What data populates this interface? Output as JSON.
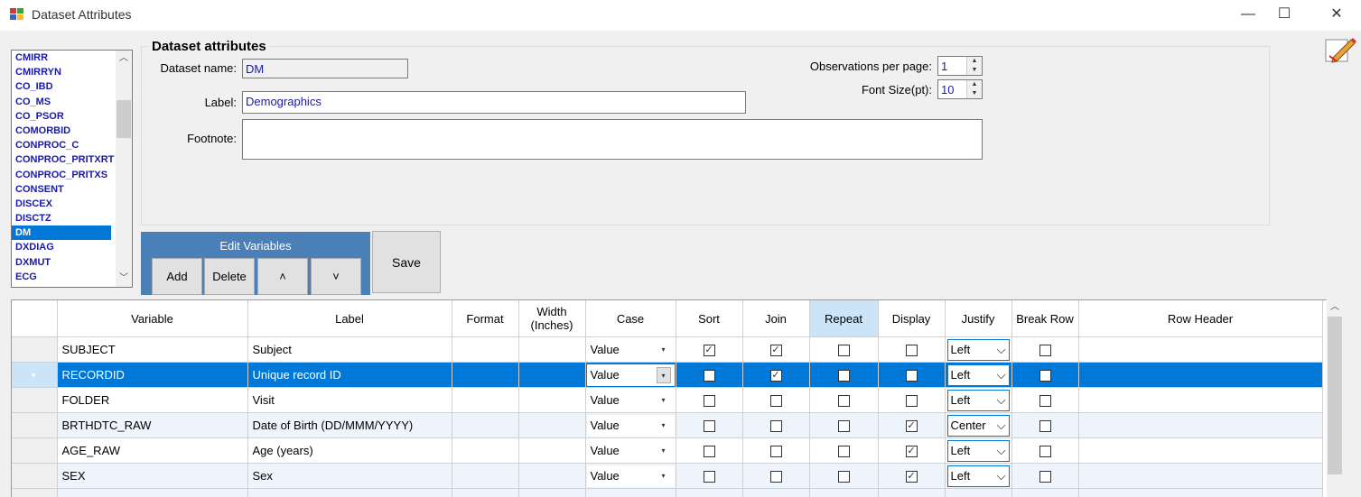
{
  "window": {
    "title": "Dataset Attributes",
    "minimize": "—",
    "maximize": "☐",
    "close": "✕"
  },
  "datasets": {
    "items": [
      "CMIRR",
      "CMIRRYN",
      "CO_IBD",
      "CO_MS",
      "CO_PSOR",
      "COMORBID",
      "CONPROC_C",
      "CONPROC_PRITXRT",
      "CONPROC_PRITXS",
      "CONSENT",
      "DISCEX",
      "DISCTZ",
      "DM",
      "DXDIAG",
      "DXMUT",
      "ECG"
    ],
    "selected": "DM"
  },
  "attributes": {
    "group_title": "Dataset attributes",
    "name_label": "Dataset name:",
    "name_value": "DM",
    "label_label": "Label:",
    "label_value": "Demographics",
    "footnote_label": "Footnote:",
    "footnote_value": "",
    "obs_label": "Observations per page:",
    "obs_value": "1",
    "font_label": "Font Size(pt):",
    "font_value": "10"
  },
  "edit_vars": {
    "title": "Edit Variables",
    "add": "Add",
    "delete": "Delete",
    "up": "˄",
    "down": "˅"
  },
  "save_label": "Save",
  "grid": {
    "columns": [
      "Variable",
      "Label",
      "Format",
      "Width (Inches)",
      "Case",
      "Sort",
      "Join",
      "Repeat",
      "Display",
      "Justify",
      "Break Row",
      "Row Header"
    ],
    "rows": [
      {
        "variable": "SUBJECT",
        "label": "Subject",
        "format": "",
        "width": "",
        "case": "Value",
        "sort": true,
        "join": true,
        "repeat": false,
        "display": false,
        "justify": "Left",
        "break": false,
        "rowheader": ""
      },
      {
        "variable": "RECORDID",
        "label": "Unique record ID",
        "format": "",
        "width": "",
        "case": "Value",
        "sort": false,
        "join": true,
        "repeat": false,
        "display": false,
        "justify": "Left",
        "break": false,
        "rowheader": ""
      },
      {
        "variable": "FOLDER",
        "label": "Visit",
        "format": "",
        "width": "",
        "case": "Value",
        "sort": false,
        "join": false,
        "repeat": false,
        "display": false,
        "justify": "Left",
        "break": false,
        "rowheader": ""
      },
      {
        "variable": "BRTHDTC_RAW",
        "label": "Date of Birth (DD/MMM/YYYY)",
        "format": "",
        "width": "",
        "case": "Value",
        "sort": false,
        "join": false,
        "repeat": false,
        "display": true,
        "justify": "Center",
        "break": false,
        "rowheader": ""
      },
      {
        "variable": "AGE_RAW",
        "label": "Age (years)",
        "format": "",
        "width": "",
        "case": "Value",
        "sort": false,
        "join": false,
        "repeat": false,
        "display": true,
        "justify": "Left",
        "break": false,
        "rowheader": ""
      },
      {
        "variable": "SEX",
        "label": "Sex",
        "format": "",
        "width": "",
        "case": "Value",
        "sort": false,
        "join": false,
        "repeat": false,
        "display": true,
        "justify": "Left",
        "break": false,
        "rowheader": ""
      }
    ],
    "selected_row": 1,
    "current_row_marker": "▸",
    "highlight_column": "Repeat"
  },
  "icons": {
    "check": "✓",
    "dropdown": "▾",
    "chevron": "⌵",
    "up": "▲",
    "down": "▼"
  }
}
